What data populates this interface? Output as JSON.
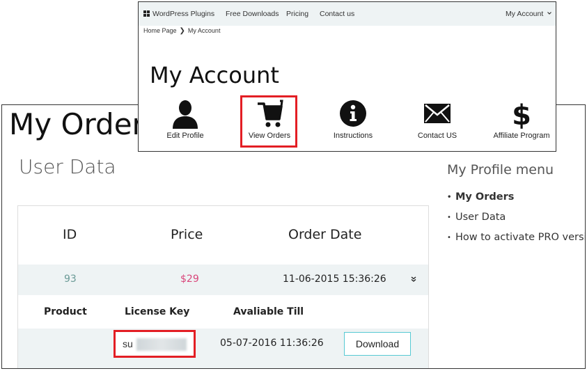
{
  "my_orders": {
    "title": "My Orders",
    "section_heading": "User Data",
    "table": {
      "headers": [
        "ID",
        "Price",
        "Order Date"
      ],
      "row": {
        "id": "93",
        "price": "$29",
        "order_date": "11-06-2015 15:36:26"
      },
      "sub_headers": [
        "Product",
        "License Key",
        "Avaliable Till"
      ],
      "product_row": {
        "product": "",
        "license_key_visible": "su",
        "available_till": "05-07-2016 11:36:26",
        "download_label": "Download"
      }
    },
    "profile_menu": {
      "title": "My Profile menu",
      "items": [
        {
          "label": "My Orders",
          "active": true
        },
        {
          "label": "User Data",
          "active": false
        },
        {
          "label": "How to activate PRO version",
          "active": false
        }
      ]
    },
    "colors": {
      "id_text": "#6a9a96",
      "price_text": "#d9457a",
      "row_bg": "#eef3f4",
      "download_border": "#56c9d3",
      "highlight": "#e31e24"
    }
  },
  "my_account": {
    "nav": {
      "brand": "WordPress Plugins",
      "items": [
        "Free Downloads",
        "Pricing",
        "Contact us"
      ],
      "account_menu": "My Account"
    },
    "breadcrumb": [
      "Home Page",
      "My Account"
    ],
    "title": "My Account",
    "tiles": [
      {
        "label": "Edit Profile",
        "icon": "user-icon"
      },
      {
        "label": "View Orders",
        "icon": "cart-icon"
      },
      {
        "label": "Instructions",
        "icon": "info-icon"
      },
      {
        "label": "Contact US",
        "icon": "envelope-icon"
      },
      {
        "label": "Affiliate Program",
        "icon": "dollar-icon"
      }
    ]
  }
}
